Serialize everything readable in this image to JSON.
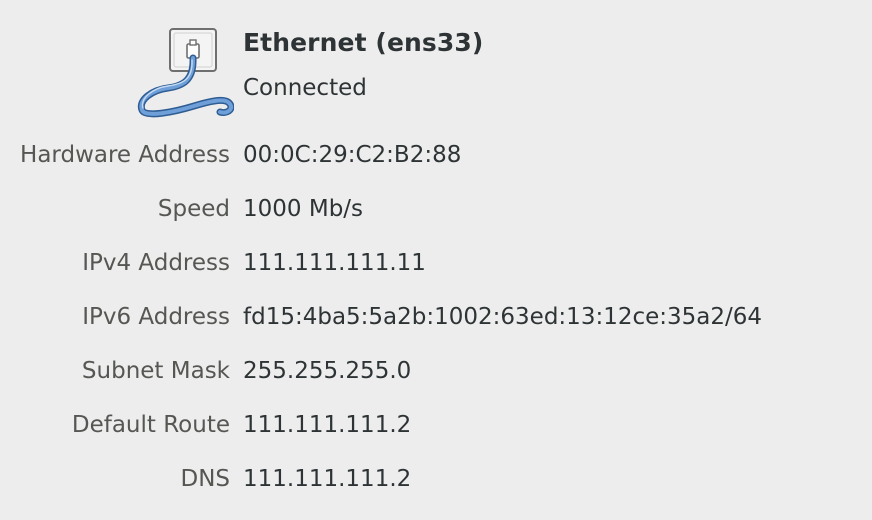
{
  "device": {
    "icon": "ethernet-cable-icon",
    "title": "Ethernet (ens33)",
    "status": "Connected"
  },
  "details": [
    {
      "label": "Hardware Address",
      "value": "00:0C:29:C2:B2:88"
    },
    {
      "label": "Speed",
      "value": "1000 Mb/s"
    },
    {
      "label": "IPv4 Address",
      "value": "111.111.111.11"
    },
    {
      "label": "IPv6 Address",
      "value": "fd15:4ba5:5a2b:1002:63ed:13:12ce:35a2/64"
    },
    {
      "label": "Subnet Mask",
      "value": "255.255.255.0"
    },
    {
      "label": "Default Route",
      "value": "111.111.111.2"
    },
    {
      "label": "DNS",
      "value": "111.111.111.2"
    }
  ],
  "colors": {
    "background": "#ededed",
    "text": "#2e3436",
    "label": "#555753",
    "cable": "#4a7fc1"
  }
}
